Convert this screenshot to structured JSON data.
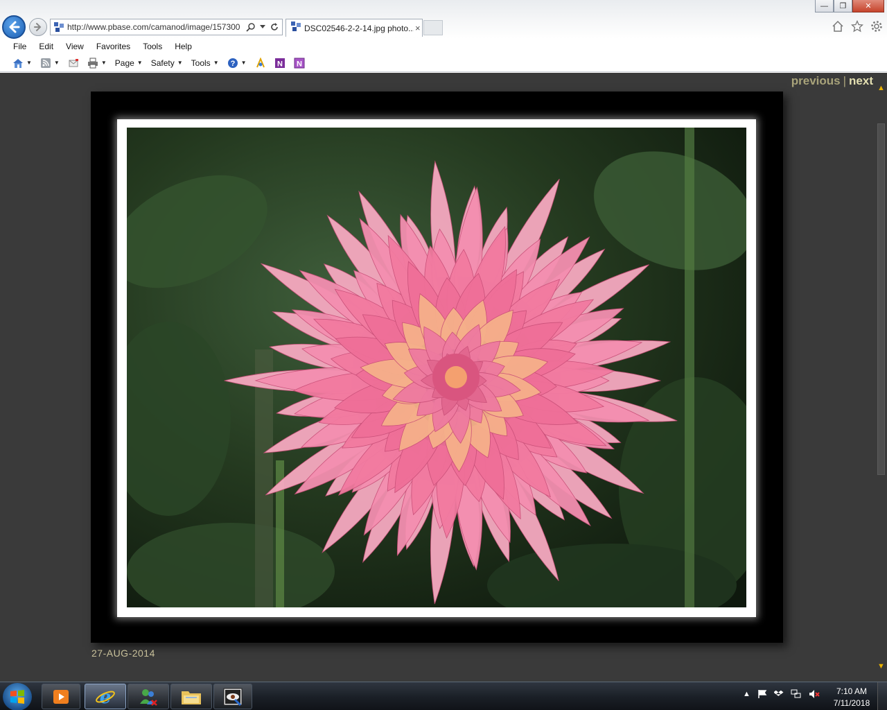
{
  "browser": {
    "address_url": "http://www.pbase.com/camanod/image/157300",
    "tab_title": "DSC02546-2-2-14.jpg photo...",
    "tab_close": "×",
    "menu": [
      "File",
      "Edit",
      "View",
      "Favorites",
      "Tools",
      "Help"
    ],
    "command_bar": {
      "page_label": "Page",
      "safety_label": "Safety",
      "tools_label": "Tools"
    },
    "window_buttons": {
      "minimize": "—",
      "restore": "❐",
      "close": "✕"
    }
  },
  "page": {
    "previous_label": "previous",
    "separator": "|",
    "next_label": "next",
    "image_date": "27-AUG-2014",
    "colors": {
      "background": "#3a3a3a",
      "nav_link": "#a8a37a",
      "nav_link_active": "#e3dfb1",
      "caption": "#c8c09a",
      "flower_pink": "#f27aa0",
      "flower_peach": "#f6b08a"
    }
  },
  "taskbar": {
    "items": [
      "windows-media-player",
      "internet-explorer",
      "messenger",
      "file-explorer",
      "image-viewer"
    ],
    "clock_time": "7:10 AM",
    "clock_date": "7/11/2018"
  }
}
